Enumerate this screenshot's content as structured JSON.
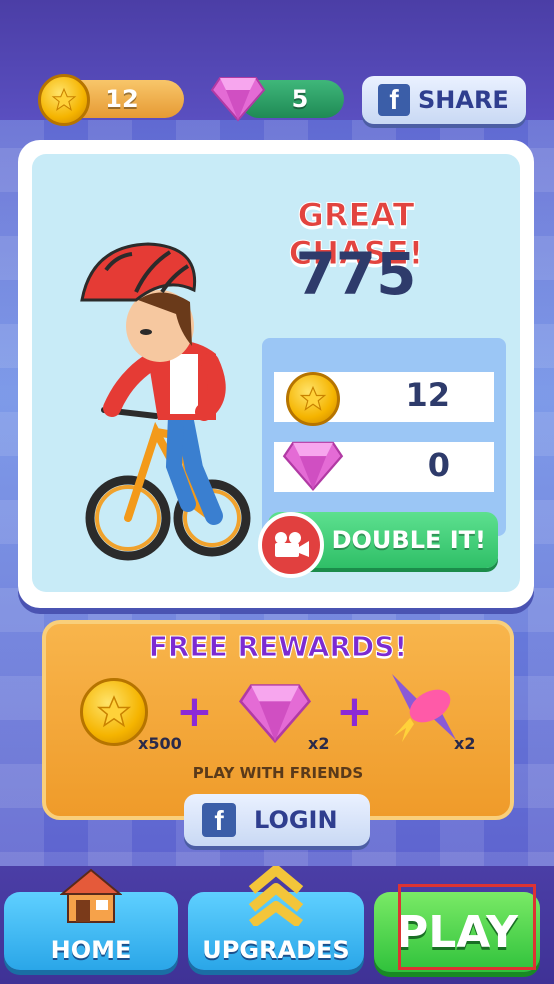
{
  "currency": {
    "coins": "12",
    "gems": "5"
  },
  "share_label": "SHARE",
  "result": {
    "title": "GREAT CHASE!",
    "score": "775",
    "coins_earned": "12",
    "gems_earned": "0"
  },
  "double_label": "DOUBLE IT!",
  "free_rewards": {
    "title": "FREE REWARDS!",
    "coin_mult": "x500",
    "gem_mult": "x2",
    "rocket_mult": "x2",
    "subtitle": "PLAY WITH FRIENDS"
  },
  "login_label": "LOGIN",
  "nav": {
    "home": "HOME",
    "upgrades": "UPGRADES",
    "play": "PLAY"
  },
  "colors": {
    "coin": "#f5b400",
    "gem": "#e46bd5",
    "play": "#30c23c",
    "accent_red": "#e2443f",
    "purple": "#7c2bd2"
  }
}
